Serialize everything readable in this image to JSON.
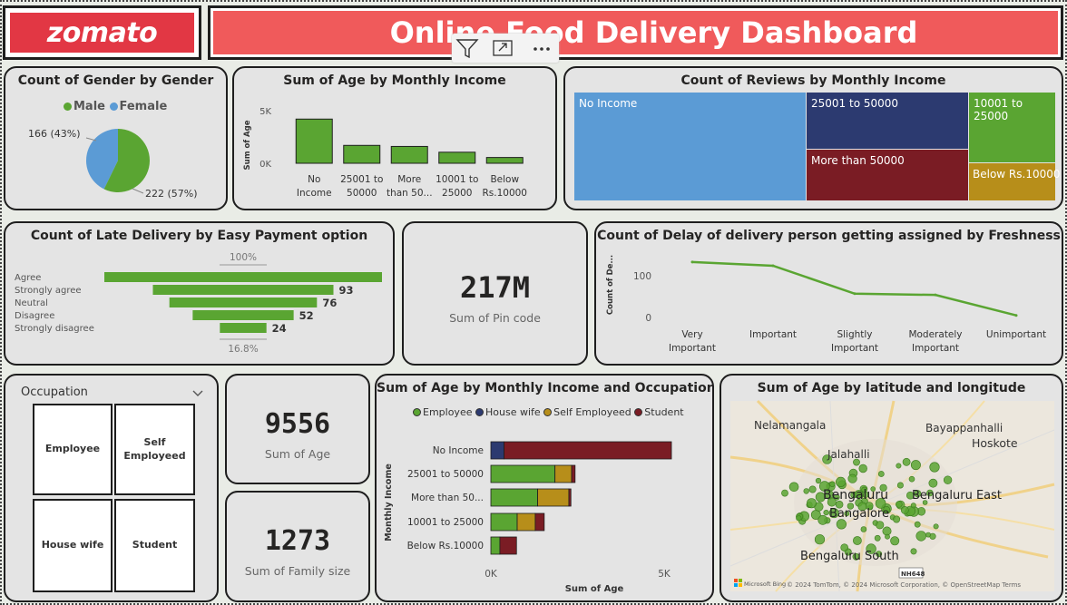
{
  "header": {
    "logo_text": "zomato",
    "title": "Online Food Delivery Dashboard",
    "toolbar_colors": {
      "logo": "#e23744",
      "banner": "#f05a5b"
    }
  },
  "gender": {
    "title": "Count of Gender by Gender",
    "legend": [
      {
        "label": "Male",
        "color": "#5aa532"
      },
      {
        "label": "Female",
        "color": "#5b9bd5"
      }
    ],
    "male_label": "222 (57%)",
    "female_label": "166 (43%)"
  },
  "age_income": {
    "title": "Sum of Age by Monthly Income",
    "ylabel": "Sum of Age",
    "ticks": [
      "5K",
      "0K"
    ],
    "categories": [
      [
        "No",
        "Income"
      ],
      [
        "25001 to",
        "50000"
      ],
      [
        "More",
        "than 50..."
      ],
      [
        "10001 to",
        "25000"
      ],
      [
        "Below",
        "Rs.10000"
      ]
    ]
  },
  "reviews": {
    "title": "Count of Reviews by Monthly Income",
    "tiles": [
      {
        "label": "No Income",
        "color": "#5b9bd5"
      },
      {
        "label": "25001 to 50000",
        "color": "#2c3a70"
      },
      {
        "label": "More than 50000",
        "color": "#7a1c24"
      },
      {
        "label": "10001 to 25000",
        "color": "#5aa532"
      },
      {
        "label": "Below Rs.10000",
        "color": "#b78e1a"
      }
    ]
  },
  "late_delivery": {
    "title": "Count of Late Delivery by Easy Payment option",
    "top_label": "100%",
    "bottom_label": "16.8%",
    "rows": [
      {
        "label": "Agree",
        "value": ""
      },
      {
        "label": "Strongly agree",
        "value": "93"
      },
      {
        "label": "Neutral",
        "value": "76"
      },
      {
        "label": "Disagree",
        "value": "52"
      },
      {
        "label": "Strongly disagree",
        "value": "24"
      }
    ]
  },
  "pin": {
    "value": "217M",
    "label": "Sum of Pin code"
  },
  "delay": {
    "title": "Count of Delay of delivery person getting assigned by Freshness",
    "ylabel": "Count of De...",
    "ticks": [
      "100",
      "0"
    ],
    "categories": [
      [
        "Very",
        "Important"
      ],
      [
        "Important",
        ""
      ],
      [
        "Slightly",
        "Important"
      ],
      [
        "Moderately",
        "Important"
      ],
      [
        "Unimportant",
        ""
      ]
    ]
  },
  "occupation": {
    "label": "Occupation",
    "options": [
      [
        "Employee"
      ],
      [
        "Self",
        "Employeed"
      ],
      [
        "House wife"
      ],
      [
        "Student"
      ]
    ]
  },
  "age_kpi": {
    "value": "9556",
    "label": "Sum of Age"
  },
  "family_kpi": {
    "value": "1273",
    "label": "Sum of Family size"
  },
  "stacked": {
    "title": "Sum of Age by Monthly Income and Occupation",
    "legend": [
      {
        "label": "Employee",
        "color": "#5aa532"
      },
      {
        "label": "House wife",
        "color": "#2c3a70"
      },
      {
        "label": "Self Employeed",
        "color": "#b78e1a"
      },
      {
        "label": "Student",
        "color": "#7a1c24"
      }
    ],
    "ylabel": "Monthly Income",
    "xlabel": "Sum of Age",
    "xticks": [
      "0K",
      "5K"
    ],
    "categories": [
      "No Income",
      "25001 to 50000",
      "More than 50...",
      "10001 to 25000",
      "Below Rs.10000"
    ]
  },
  "map": {
    "title": "Sum of Age by latitude and longitude",
    "places": [
      "Nelamangala",
      "Bayappanhalli",
      "Hoskote",
      "Jalahalli",
      "Bengaluru",
      "Bengaluru East",
      "Bangalore",
      "Bengaluru South"
    ],
    "road_badge": "NH648",
    "attribution": "Microsoft Bing",
    "copyright": "© 2024 TomTom, © 2024 Microsoft Corporation, © OpenStreetMap  Terms"
  },
  "chart_data": [
    {
      "type": "pie",
      "title": "Count of Gender by Gender",
      "categories": [
        "Male",
        "Female"
      ],
      "values": [
        222,
        166
      ],
      "percent": [
        57,
        43
      ],
      "legend": "top"
    },
    {
      "type": "bar",
      "title": "Sum of Age by Monthly Income",
      "categories": [
        "No Income",
        "25001 to 50000",
        "More than 50000",
        "10001 to 25000",
        "Below Rs.10000"
      ],
      "values": [
        4200,
        1700,
        1600,
        1050,
        550
      ],
      "ylabel": "Sum of Age",
      "ylim": [
        0,
        6000
      ],
      "color": "#5aa532"
    },
    {
      "type": "treemap",
      "title": "Count of Reviews by Monthly Income",
      "categories": [
        "No Income",
        "25001 to 50000",
        "More than 50000",
        "10001 to 25000",
        "Below Rs.10000"
      ],
      "values": [
        187,
        69,
        62,
        45,
        25
      ]
    },
    {
      "type": "bar",
      "title": "Count of Late Delivery by Easy Payment option",
      "orientation": "horizontal-funnel",
      "categories": [
        "Agree",
        "Strongly agree",
        "Neutral",
        "Disagree",
        "Strongly disagree"
      ],
      "values": [
        143,
        93,
        76,
        52,
        24
      ],
      "color": "#5aa532"
    },
    {
      "type": "line",
      "title": "Count of Delay of delivery person getting assigned by Freshness",
      "categories": [
        "Very Important",
        "Important",
        "Slightly Important",
        "Moderately Important",
        "Unimportant"
      ],
      "values": [
        133,
        124,
        57,
        54,
        5
      ],
      "ylim": [
        0,
        140
      ],
      "color": "#5aa532"
    },
    {
      "type": "bar",
      "title": "Sum of Age by Monthly Income and Occupation",
      "orientation": "horizontal-stacked",
      "categories": [
        "No Income",
        "25001 to 50000",
        "More than 50...",
        "10001 to 25000",
        "Below Rs.10000"
      ],
      "series": [
        {
          "name": "Employee",
          "values": [
            0,
            1850,
            1350,
            760,
            260
          ]
        },
        {
          "name": "House wife",
          "values": [
            380,
            0,
            0,
            0,
            0
          ]
        },
        {
          "name": "Self Employeed",
          "values": [
            0,
            480,
            900,
            520,
            0
          ]
        },
        {
          "name": "Student",
          "values": [
            4830,
            100,
            60,
            260,
            480
          ]
        }
      ],
      "xlim": [
        0,
        6000
      ],
      "xlabel": "Sum of Age",
      "ylabel": "Monthly Income"
    },
    {
      "type": "scatter",
      "title": "Sum of Age by latitude and longitude",
      "note": "map bubbles over Bengaluru"
    }
  ]
}
